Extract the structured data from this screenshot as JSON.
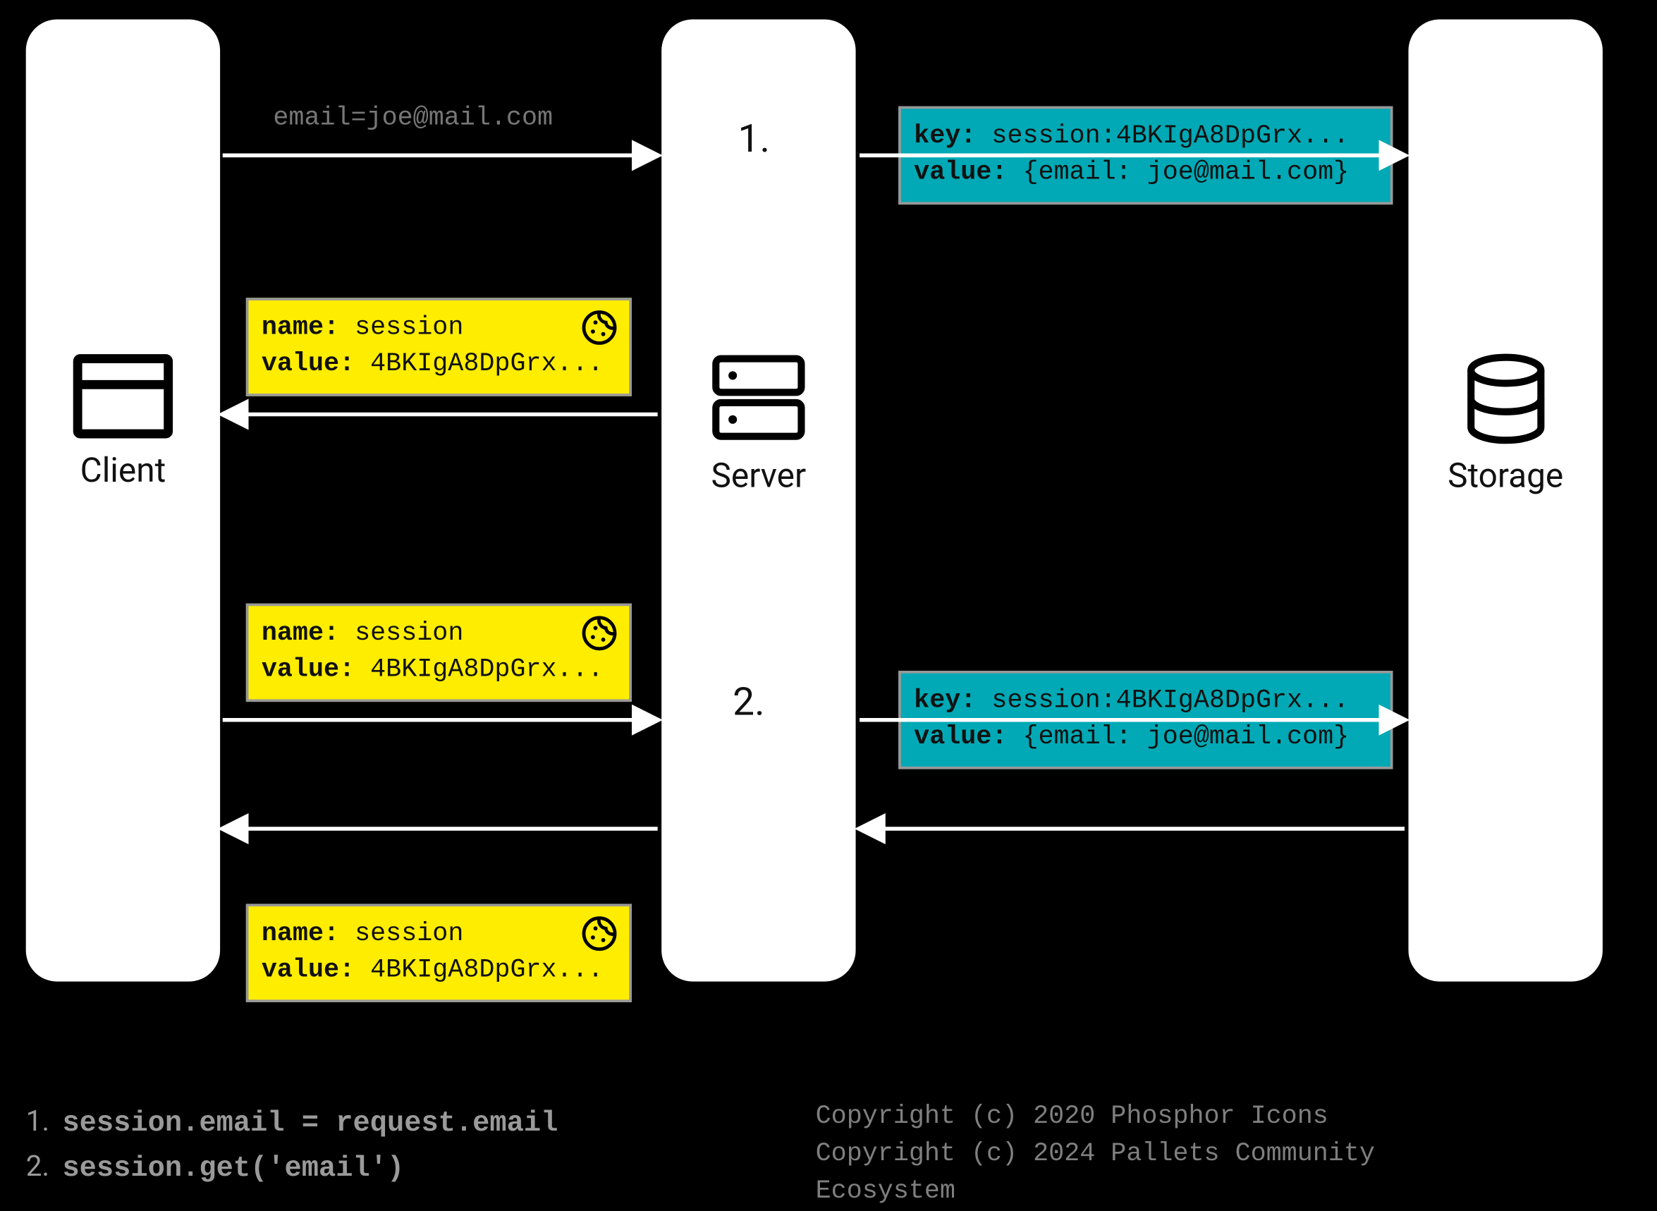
{
  "pillars": {
    "client": {
      "label": "Client"
    },
    "server": {
      "label": "Server"
    },
    "storage": {
      "label": "Storage"
    }
  },
  "request": {
    "text": "email=joe@mail.com"
  },
  "stepMarkers": {
    "one": "1.",
    "two": "2."
  },
  "cookies": {
    "name_label": "name:",
    "value_label": "value:",
    "name": "session",
    "value": "4BKIgA8DpGrx..."
  },
  "storageEntries": {
    "key_label": "key:",
    "value_label": "value:",
    "key": "session:4BKIgA8DpGrx...",
    "value": "{email: joe@mail.com}"
  },
  "footerSteps": {
    "one_num": "1.",
    "one_text": "session.email = request.email",
    "two_num": "2.",
    "two_text": "session.get('email')"
  },
  "copyright": {
    "line1": "Copyright (c) 2020 Phosphor Icons",
    "line2": "Copyright (c) 2024 Pallets Community Ecosystem"
  }
}
